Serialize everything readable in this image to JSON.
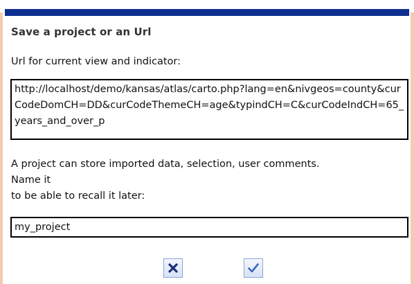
{
  "dialog": {
    "title": "Save a project or an Url",
    "url_label": "Url for current view and indicator:",
    "url_value": "http://localhost/demo/kansas/atlas/carto.php?lang=en&nivgeos=county&curCodeDomCH=DD&curCodeThemeCH=age&typindCH=C&curCodeIndCH=65_years_and_over_p",
    "project_description": "A project can store imported data, selection, user comments.\nName it\nto be able to recall it later:",
    "project_name_value": "my_project",
    "buttons": [
      {
        "name": "cancel",
        "icon": "close-icon"
      },
      {
        "name": "confirm",
        "icon": "check-icon"
      }
    ]
  },
  "colors": {
    "title_bar": "#0d2f8f",
    "frame_edge": "#f4ccb0",
    "cancel_icon": "#1b2f77",
    "confirm_icon": "#3a66c4",
    "button_border": "#8aa6d8"
  }
}
